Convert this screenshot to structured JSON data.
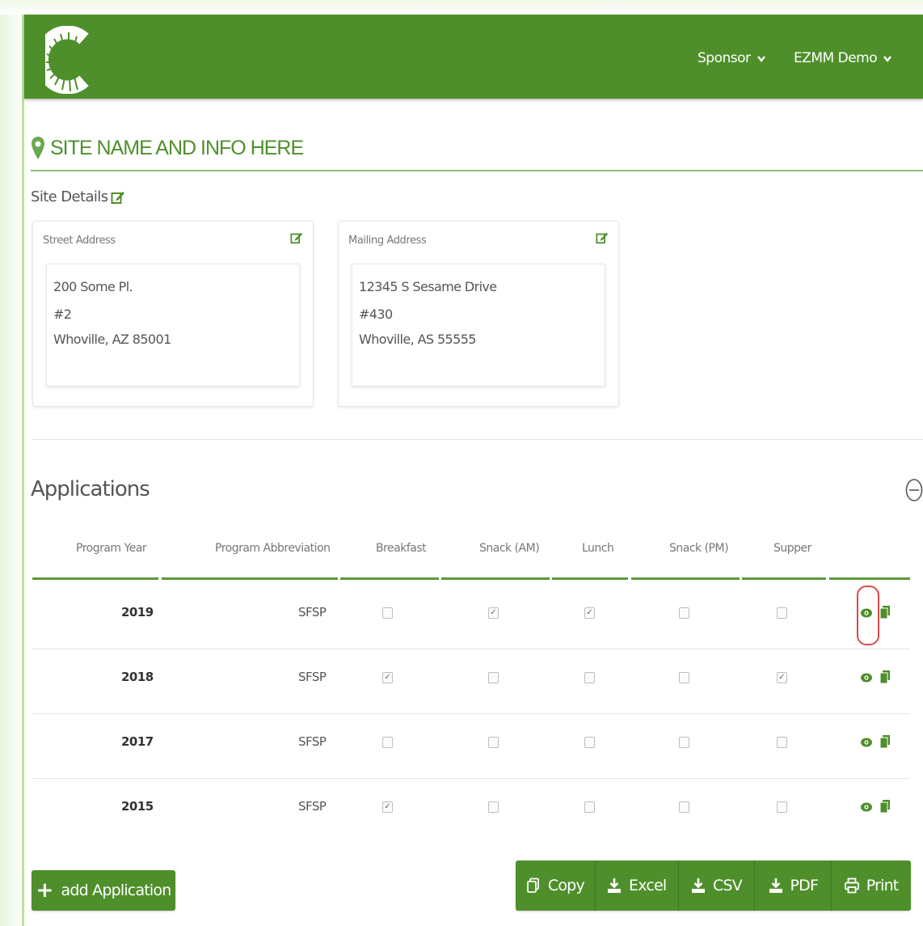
{
  "header": {
    "logo_letter": "C",
    "nav": [
      {
        "label": "Sponsor"
      },
      {
        "label": "EZMM Demo"
      }
    ]
  },
  "site": {
    "title": "SITE NAME AND INFO HERE",
    "details_label": "Site Details",
    "street": {
      "label": "Street Address",
      "lines": [
        "200 Some Pl.",
        "#2",
        "Whoville, AZ 85001"
      ]
    },
    "mailing": {
      "label": "Mailing Address",
      "lines": [
        "12345 S Sesame Drive",
        "#430",
        "Whoville, AS 55555"
      ]
    }
  },
  "applications": {
    "title": "Applications",
    "columns": [
      "Program Year",
      "Program Abbreviation",
      "Breakfast",
      "Snack (AM)",
      "Lunch",
      "Snack (PM)",
      "Supper"
    ],
    "rows": [
      {
        "year": "2019",
        "abbr": "SFSP",
        "meals": [
          false,
          true,
          true,
          false,
          false
        ]
      },
      {
        "year": "2018",
        "abbr": "SFSP",
        "meals": [
          true,
          false,
          false,
          false,
          true
        ]
      },
      {
        "year": "2017",
        "abbr": "SFSP",
        "meals": [
          false,
          false,
          false,
          false,
          false
        ]
      },
      {
        "year": "2015",
        "abbr": "SFSP",
        "meals": [
          true,
          false,
          false,
          false,
          false
        ]
      }
    ],
    "add_label": "add Application",
    "export_buttons": [
      {
        "label": "Copy",
        "icon": "copy-icon"
      },
      {
        "label": "Excel",
        "icon": "download-icon"
      },
      {
        "label": "CSV",
        "icon": "download-icon"
      },
      {
        "label": "PDF",
        "icon": "download-icon"
      },
      {
        "label": "Print",
        "icon": "print-icon"
      }
    ]
  },
  "colors": {
    "brand": "#4f8f2b",
    "highlight": "#d84a4a"
  }
}
